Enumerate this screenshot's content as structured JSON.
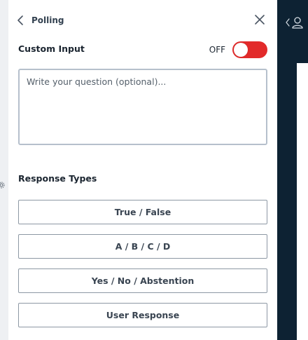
{
  "header": {
    "back_label": "Polling"
  },
  "custom_input": {
    "label": "Custom Input",
    "toggle_state": "OFF",
    "toggle_on": false,
    "toggle_color": "#e22a2a"
  },
  "question": {
    "placeholder": "Write your question (optional)..."
  },
  "response_types": {
    "title": "Response Types",
    "options": [
      {
        "label": "True / False"
      },
      {
        "label": "A / B / C / D"
      },
      {
        "label": "Yes / No / Abstention"
      },
      {
        "label": "User Response"
      }
    ]
  },
  "colors": {
    "side_dark": "#0d2233",
    "border": "#b6c0cc"
  }
}
